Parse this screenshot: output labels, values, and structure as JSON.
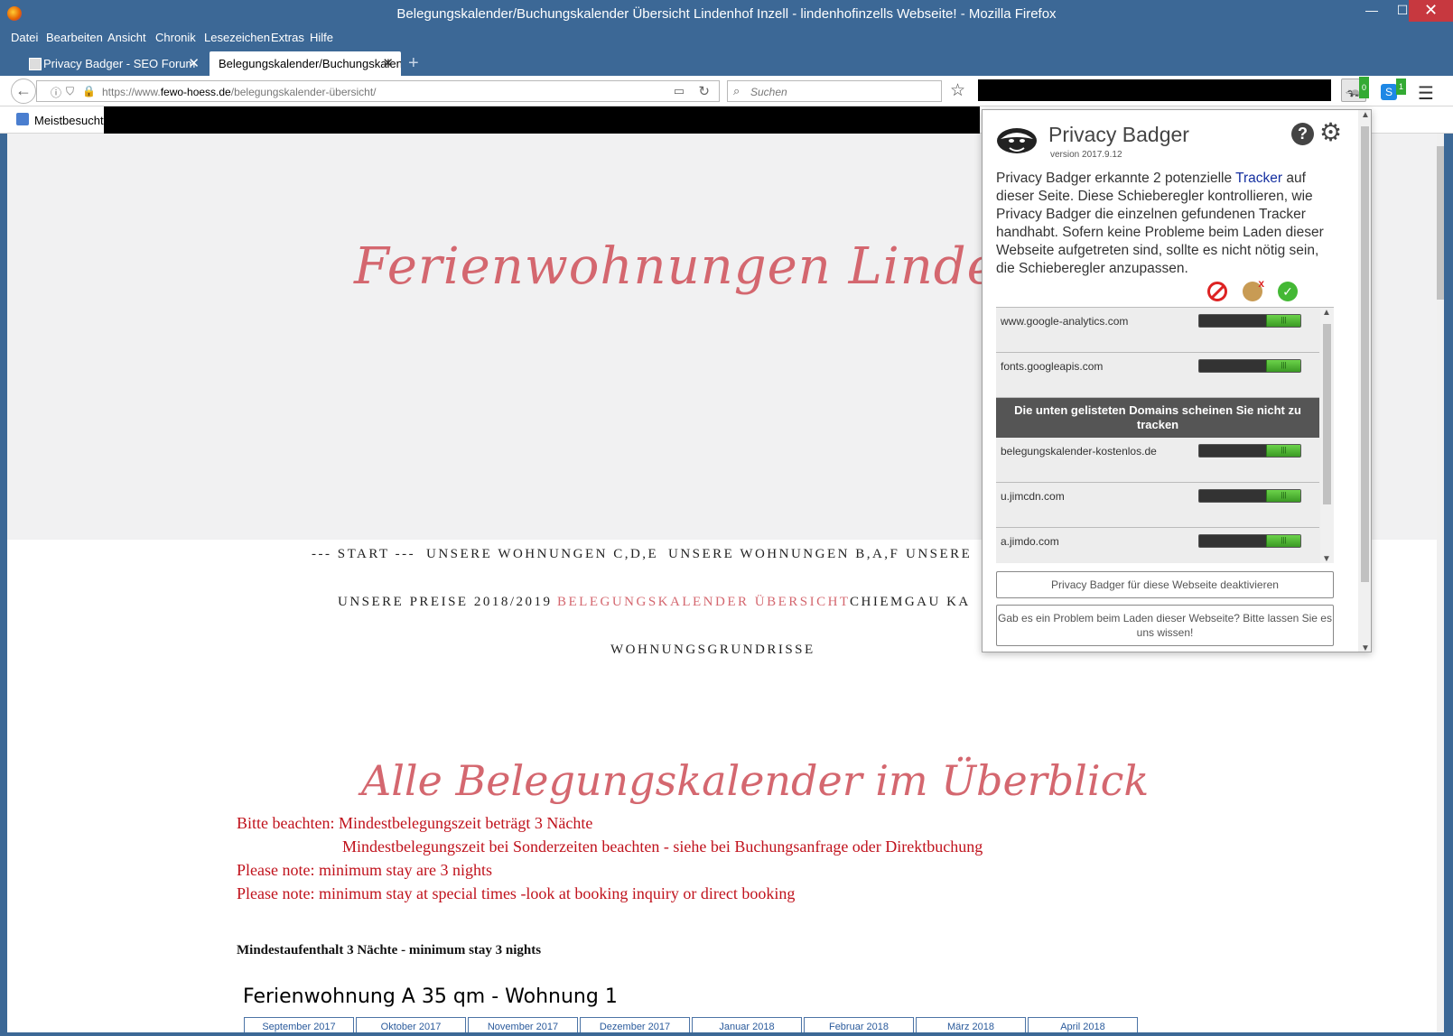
{
  "window": {
    "title": "Belegungskalender/Buchungskalender Übersicht Lindenhof Inzell - lindenhofinzells Webseite! - Mozilla Firefox",
    "min": "—",
    "max": "☐",
    "close": "✕"
  },
  "menu": [
    "Datei",
    "Bearbeiten",
    "Ansicht",
    "Chronik",
    "Lesezeichen",
    "Extras",
    "Hilfe"
  ],
  "tabs": [
    {
      "label": "Privacy Badger - SEO Forum",
      "active": false
    },
    {
      "label": "Belegungskalender/Buchungskalender",
      "active": true
    }
  ],
  "new_tab": "+",
  "nav": {
    "back": "←",
    "url_prefix": "https://www.",
    "url_domain": "fewo-hoess.de",
    "url_path": "/belegungskalender-übersicht/",
    "search_placeholder": "Suchen",
    "pb_badge": "0",
    "skype_badge": "1",
    "skype_letter": "S"
  },
  "bookmarks": {
    "label": "Meistbesucht"
  },
  "page": {
    "hero_title": "Ferienwohnungen Lindenhof in I",
    "nav_row1": [
      "--- START ---",
      "UNSERE WOHNUNGEN C,D,E",
      "UNSERE WOHNUNGEN B,A,F",
      "UNSERE"
    ],
    "nav_row2": [
      "UNSERE PREISE 2018/2019",
      "BELEGUNGSKALENDER ÜBERSICHT",
      "CHIEMGAU KA"
    ],
    "nav_row3": [
      "WOHNUNGSGRUNDRISSE"
    ],
    "heading": "Alle Belegungskalender im Überblick",
    "notices": [
      "Bitte beachten: Mindestbelegungszeit beträgt 3 Nächte",
      "Mindestbelegungszeit bei Sonderzeiten beachten - siehe bei Buchungsanfrage oder Direktbuchung",
      "Please note: minimum stay are 3 nights",
      "Please note:  minimum stay at special times -look at booking inquiry or direct booking"
    ],
    "min_stay": "Mindestaufenthalt 3 Nächte - minimum stay 3 nights",
    "apartment_title": "Ferienwohnung A 35 qm - Wohnung 1",
    "calendar_tabs": [
      "September 2017",
      "Oktober 2017",
      "November 2017",
      "Dezember 2017",
      "Januar 2018",
      "Februar 2018",
      "März 2018",
      "April 2018"
    ]
  },
  "privacy_badger": {
    "name": "Privacy Badger",
    "version": "version 2017.9.12",
    "help": "?",
    "gear": "⚙",
    "desc_before": "Privacy Badger erkannte 2 potenzielle ",
    "desc_link": "Tracker",
    "desc_after": " auf dieser Seite. Diese Schieberegler kontrollieren, wie Privacy Badger die einzelnen gefundenen Tracker handhabt. Sofern keine Probleme beim Laden dieser Webseite aufgetreten sind, sollte es nicht nötig sein, die Schieberegler anzupassen.",
    "legend_allow": "✓",
    "trackers": [
      "www.google-analytics.com",
      "fonts.googleapis.com"
    ],
    "separator": "Die unten gelisteten Domains scheinen Sie nicht zu tracken",
    "non_trackers": [
      "belegungskalender-kostenlos.de",
      "u.jimcdn.com",
      "a.jimdo.com"
    ],
    "slider_state": "allow",
    "knob": "|||",
    "disable_button": "Privacy Badger für diese Webseite deaktivieren",
    "report_button": "Gab es ein Problem beim Laden dieser Webseite? Bitte lassen Sie es uns wissen!"
  }
}
